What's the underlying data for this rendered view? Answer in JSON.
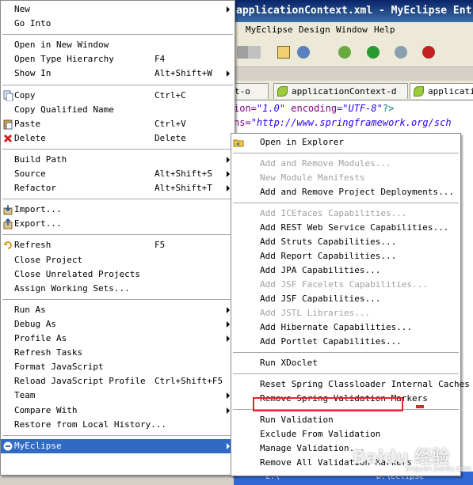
{
  "window": {
    "title": "applicationContext.xml - MyEclipse Ent"
  },
  "menubar": [
    "MyEclipse",
    "Design",
    "Window",
    "Help"
  ],
  "tabs": [
    "t-o",
    "applicationContext-d",
    "applicatio"
  ],
  "editor_lines": [
    {
      "a": "ion=",
      "b": "\"1.0\"",
      "c": " encoding=",
      "d": "\"UTF-8\"",
      "e": "?>"
    },
    {
      "a": "ns=",
      "b": "\"http://www.springframework.org/sch",
      "c": "",
      "d": "",
      "e": ""
    }
  ],
  "context_menu": {
    "items": [
      {
        "label": "New",
        "shortcut": "",
        "submenu": true
      },
      {
        "label": "Go Into",
        "shortcut": "",
        "submenu": false
      },
      {
        "sep": true
      },
      {
        "label": "Open in New Window",
        "shortcut": "",
        "submenu": false
      },
      {
        "label": "Open Type Hierarchy",
        "shortcut": "F4",
        "submenu": false
      },
      {
        "label": "Show In",
        "shortcut": "Alt+Shift+W",
        "submenu": true
      },
      {
        "sep": true
      },
      {
        "label": "Copy",
        "shortcut": "Ctrl+C",
        "submenu": false,
        "icon": "copy-icon"
      },
      {
        "label": "Copy Qualified Name",
        "shortcut": "",
        "submenu": false
      },
      {
        "label": "Paste",
        "shortcut": "Ctrl+V",
        "submenu": false,
        "icon": "paste-icon"
      },
      {
        "label": "Delete",
        "shortcut": "Delete",
        "submenu": false,
        "icon": "delete-icon"
      },
      {
        "sep": true
      },
      {
        "label": "Build Path",
        "shortcut": "",
        "submenu": true
      },
      {
        "label": "Source",
        "shortcut": "Alt+Shift+S",
        "submenu": true
      },
      {
        "label": "Refactor",
        "shortcut": "Alt+Shift+T",
        "submenu": true
      },
      {
        "sep": true
      },
      {
        "label": "Import...",
        "shortcut": "",
        "submenu": false,
        "icon": "import-icon"
      },
      {
        "label": "Export...",
        "shortcut": "",
        "submenu": false,
        "icon": "export-icon"
      },
      {
        "sep": true
      },
      {
        "label": "Refresh",
        "shortcut": "F5",
        "submenu": false,
        "icon": "refresh-icon"
      },
      {
        "label": "Close Project",
        "shortcut": "",
        "submenu": false
      },
      {
        "label": "Close Unrelated Projects",
        "shortcut": "",
        "submenu": false
      },
      {
        "label": "Assign Working Sets...",
        "shortcut": "",
        "submenu": false
      },
      {
        "sep": true
      },
      {
        "label": "Run As",
        "shortcut": "",
        "submenu": true
      },
      {
        "label": "Debug As",
        "shortcut": "",
        "submenu": true
      },
      {
        "label": "Profile As",
        "shortcut": "",
        "submenu": true
      },
      {
        "label": "Refresh Tasks",
        "shortcut": "",
        "submenu": false
      },
      {
        "label": "Format JavaScript",
        "shortcut": "",
        "submenu": false
      },
      {
        "label": "Reload JavaScript Profile",
        "shortcut": "Ctrl+Shift+F5",
        "submenu": false
      },
      {
        "label": "Team",
        "shortcut": "",
        "submenu": true
      },
      {
        "label": "Compare With",
        "shortcut": "",
        "submenu": true
      },
      {
        "label": "Restore from Local History...",
        "shortcut": "",
        "submenu": false
      },
      {
        "sep": true
      },
      {
        "label": "MyEclipse",
        "shortcut": "",
        "submenu": true,
        "highlighted": true,
        "icon": "myeclipse-icon"
      }
    ]
  },
  "submenu": {
    "items": [
      {
        "label": "Open in Explorer",
        "icon": "folder-icon"
      },
      {
        "sep": true
      },
      {
        "label": "Add and Remove Modules...",
        "disabled": true
      },
      {
        "label": "New Module Manifests",
        "disabled": true
      },
      {
        "label": "Add and Remove Project Deployments..."
      },
      {
        "sep": true
      },
      {
        "label": "Add ICEfaces Capabilities...",
        "disabled": true
      },
      {
        "label": "Add REST Web Service Capabilities..."
      },
      {
        "label": "Add Struts Capabilities..."
      },
      {
        "label": "Add Report Capabilities..."
      },
      {
        "label": "Add JPA Capabilities..."
      },
      {
        "label": "Add JSF Facelets Capabilities...",
        "disabled": true
      },
      {
        "label": "Add JSF Capabilities..."
      },
      {
        "label": "Add JSTL Libraries...",
        "disabled": true
      },
      {
        "label": "Add Hibernate Capabilities..."
      },
      {
        "label": "Add Portlet Capabilities..."
      },
      {
        "sep": true
      },
      {
        "label": "Run XDoclet"
      },
      {
        "sep": true
      },
      {
        "label": "Reset Spring Classloader Internal Caches"
      },
      {
        "label": "Remove Spring Validation Markers"
      },
      {
        "sep": true
      },
      {
        "label": "Run Validation"
      },
      {
        "label": "Exclude From Validation"
      },
      {
        "label": "Manage Validation..."
      },
      {
        "label": "Remove All Validation Markers"
      }
    ]
  },
  "taskbar": [
    "Z:\\",
    "D:\\eclipse"
  ],
  "watermark": {
    "main": "Baidu 经验",
    "sub": "jingyan.baidu.com"
  },
  "colors": {
    "highlight": "#316ac5",
    "annotation": "#e4262a",
    "title": "#0a246a"
  }
}
